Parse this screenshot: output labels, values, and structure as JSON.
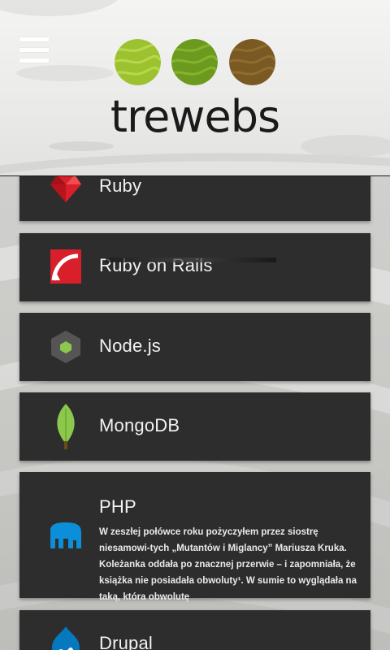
{
  "header": {
    "brand": "trewebs",
    "menu_icon": "hamburger-menu-icon",
    "circles": [
      {
        "name": "light-green-circle",
        "color": "#9cc230"
      },
      {
        "name": "green-circle",
        "color": "#6b9a1e"
      },
      {
        "name": "brown-circle",
        "color": "#7a5a22"
      }
    ]
  },
  "cards": [
    {
      "title": "Ruby",
      "icon": "ruby-icon"
    },
    {
      "title": "Ruby on Rails",
      "icon": "ruby-on-rails-icon"
    },
    {
      "title": "Node.js",
      "icon": "nodejs-icon"
    },
    {
      "title": "MongoDB",
      "icon": "mongodb-leaf-icon"
    },
    {
      "title": "PHP",
      "icon": "elephant-icon",
      "description": "W zeszłej połówce roku pożyczyłem przez siostrę niesamowi-tych „Mutantów i Miglancy” Mariusza Kruka. Koleżanka oddała po znacznej przerwie – i zapomniała, że książka nie posiadała obwoluty¹. W sumie to wyglądała na taką, która obwolutę"
    },
    {
      "title": "Drupal",
      "icon": "drupal-drop-icon"
    }
  ],
  "colors": {
    "card_bg": "#2d2d2d",
    "ruby_red": "#d81f2a",
    "node_green": "#8cc84b",
    "mongo_green": "#7cb342",
    "php_blue": "#0a8fd8",
    "drupal_blue": "#0678be"
  }
}
